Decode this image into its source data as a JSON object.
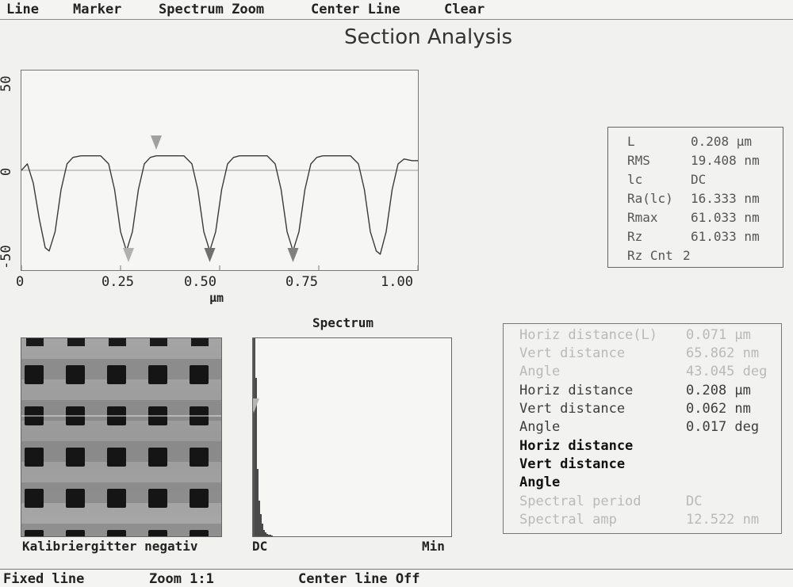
{
  "menu": [
    "Line",
    "Marker",
    "Spectrum Zoom",
    "Center Line",
    "Clear"
  ],
  "title": "Section Analysis",
  "chart_data": {
    "type": "line",
    "title": "",
    "xlabel": "μm",
    "ylabel": "",
    "xlim": [
      0,
      1.0
    ],
    "ylim": [
      -55,
      55
    ],
    "x_ticks": [
      "0",
      "0.25",
      "0.50",
      "0.75",
      "1.00"
    ],
    "y_ticks": [
      "-50",
      "0",
      "50"
    ],
    "x": [
      0.0,
      0.015,
      0.03,
      0.045,
      0.06,
      0.07,
      0.085,
      0.1,
      0.115,
      0.13,
      0.15,
      0.2,
      0.22,
      0.235,
      0.25,
      0.265,
      0.28,
      0.295,
      0.31,
      0.325,
      0.34,
      0.36,
      0.41,
      0.43,
      0.445,
      0.46,
      0.475,
      0.49,
      0.505,
      0.52,
      0.535,
      0.55,
      0.57,
      0.62,
      0.64,
      0.655,
      0.67,
      0.685,
      0.7,
      0.715,
      0.73,
      0.745,
      0.76,
      0.78,
      0.83,
      0.85,
      0.865,
      0.88,
      0.895,
      0.905,
      0.92,
      0.935,
      0.95,
      0.965,
      0.985,
      1.0
    ],
    "y": [
      0,
      4,
      -8,
      -30,
      -48,
      -50,
      -38,
      -12,
      4,
      8,
      9,
      9,
      4,
      -12,
      -38,
      -50,
      -38,
      -12,
      4,
      8,
      9,
      9,
      9,
      4,
      -12,
      -38,
      -50,
      -38,
      -12,
      4,
      8,
      9,
      9,
      9,
      4,
      -12,
      -38,
      -50,
      -38,
      -12,
      4,
      8,
      9,
      9,
      9,
      4,
      -12,
      -38,
      -50,
      -52,
      -38,
      -12,
      4,
      7,
      6,
      6
    ],
    "markers": [
      {
        "x": 0.34,
        "position": "top",
        "color": "#a0a0a0"
      },
      {
        "x": 0.27,
        "position": "bottom",
        "color": "#b0b0b0"
      },
      {
        "x": 0.475,
        "position": "bottom",
        "color": "#707070"
      },
      {
        "x": 0.685,
        "position": "bottom",
        "color": "#808080"
      }
    ]
  },
  "stats": [
    {
      "label": "L",
      "value": "0.208 μm"
    },
    {
      "label": "RMS",
      "value": "19.408 nm"
    },
    {
      "label": "lc",
      "value": "DC"
    },
    {
      "label": "Ra(lc)",
      "value": "16.333 nm"
    },
    {
      "label": "Rmax",
      "value": "61.033 nm"
    },
    {
      "label": "Rz",
      "value": "61.033 nm"
    },
    {
      "label": "Rz Cnt",
      "value": "2"
    }
  ],
  "spectrum": {
    "title": "Spectrum",
    "left_label": "DC",
    "right_label": "Min",
    "bins": [
      250,
      200,
      85,
      45,
      28,
      16,
      8,
      5,
      3,
      2,
      2,
      1
    ]
  },
  "image": {
    "caption": "Kalibriergitter negativ"
  },
  "measurements": [
    {
      "label": "Horiz distance(L)",
      "value": "0.071 μm",
      "style": "faded"
    },
    {
      "label": "Vert distance",
      "value": "65.862 nm",
      "style": "faded"
    },
    {
      "label": "Angle",
      "value": "43.045 deg",
      "style": "faded"
    },
    {
      "label": "Horiz distance",
      "value": "0.208 μm",
      "style": "normal"
    },
    {
      "label": "Vert distance",
      "value": "0.062 nm",
      "style": "normal"
    },
    {
      "label": "Angle",
      "value": "0.017 deg",
      "style": "normal"
    },
    {
      "label": "Horiz distance",
      "value": "",
      "style": "bold"
    },
    {
      "label": "Vert distance",
      "value": "",
      "style": "bold"
    },
    {
      "label": "Angle",
      "value": "",
      "style": "bold"
    },
    {
      "label": "Spectral period",
      "value": "DC",
      "style": "faded"
    },
    {
      "label": "Spectral amp",
      "value": "12.522 nm",
      "style": "faded"
    }
  ],
  "status": [
    "Fixed line",
    "Zoom 1:1",
    "Center line Off"
  ]
}
